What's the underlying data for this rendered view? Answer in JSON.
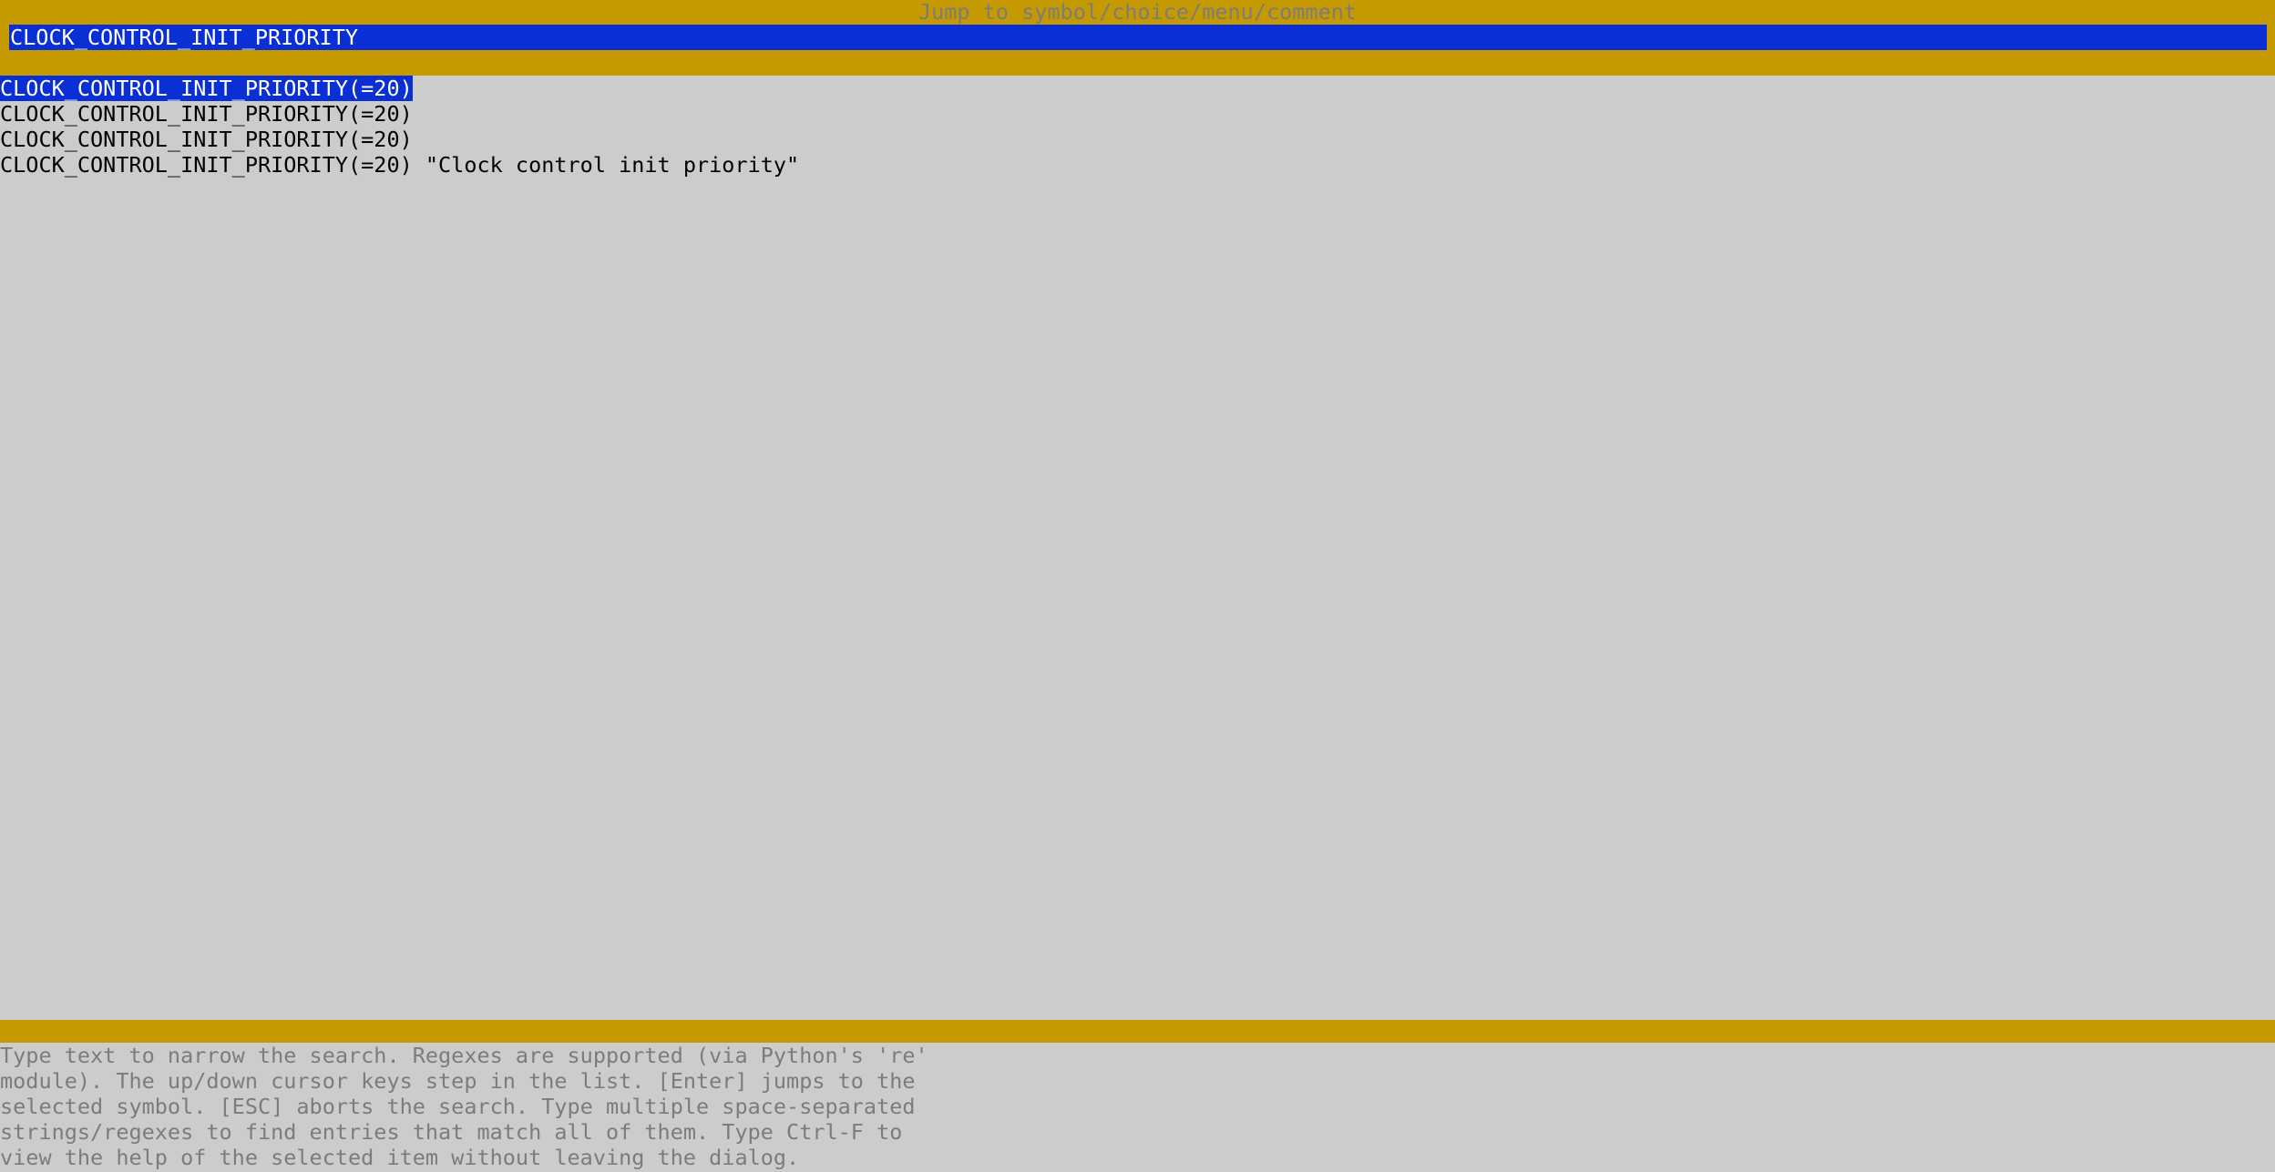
{
  "dialog": {
    "title": "Jump to symbol/choice/menu/comment"
  },
  "search": {
    "value": "CLOCK_CONTROL_INIT_PRIORITY"
  },
  "results": [
    {
      "label": "CLOCK_CONTROL_INIT_PRIORITY(=20)",
      "selected": true
    },
    {
      "label": "CLOCK_CONTROL_INIT_PRIORITY(=20)",
      "selected": false
    },
    {
      "label": "CLOCK_CONTROL_INIT_PRIORITY(=20)",
      "selected": false
    },
    {
      "label": "CLOCK_CONTROL_INIT_PRIORITY(=20) \"Clock control init priority\"",
      "selected": false
    }
  ],
  "help": {
    "lines": [
      "Type text to narrow the search. Regexes are supported (via Python's 're'",
      "module). The up/down cursor keys step in the list. [Enter] jumps to the",
      "selected symbol. [ESC] aborts the search. Type multiple space-separated",
      "strings/regexes to find entries that match all of them. Type Ctrl-F to",
      "view the help of the selected item without leaving the dialog."
    ]
  },
  "colors": {
    "border": "#c49a00",
    "background": "#cccccc",
    "highlight": "#0a2fd4",
    "dim_text": "#7c7c7c"
  }
}
